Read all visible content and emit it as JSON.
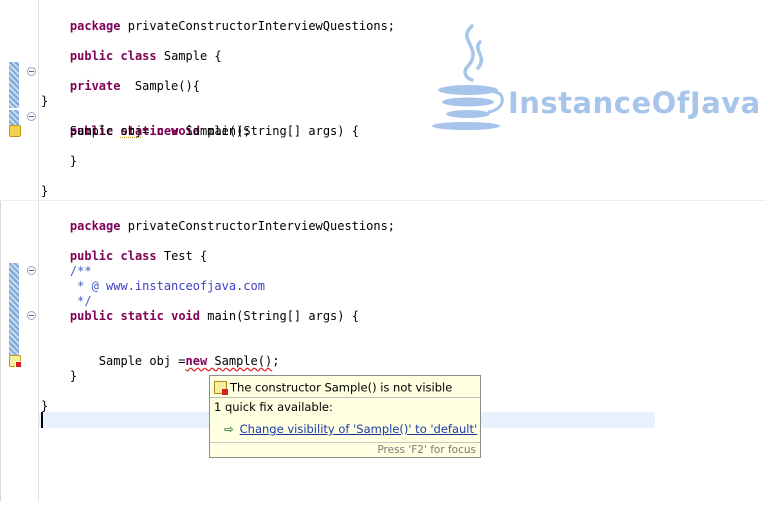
{
  "editor_top": {
    "lines": [
      "package privateConstructorInterviewQuestions;",
      "public class Sample {",
      "private  Sample(){",
      "}",
      "public static void main(String[] args) {",
      "Sample obj= new Sample();",
      "}",
      "}"
    ]
  },
  "editor_bottom": {
    "lines": [
      "package privateConstructorInterviewQuestions;",
      "public class Test {",
      "/**",
      "* @ www.instanceofjava.com",
      "*/",
      "public static void main(String[] args) {",
      "Sample obj =new Sample();",
      "}",
      "}"
    ]
  },
  "watermark": {
    "text": "InstanceOfJava",
    "icon": "java-cup-icon"
  },
  "tooltip": {
    "message": "The constructor Sample() is not visible",
    "quick_fix_count": "1 quick fix available:",
    "fix_label": "Change visibility of 'Sample()' to 'default'",
    "footer": "Press 'F2' for focus"
  },
  "colors": {
    "keyword": "#7f0055",
    "javadoc": "#3f5fbf",
    "watermark": "#a7c4ea",
    "tooltip_bg": "#ffffe1"
  }
}
